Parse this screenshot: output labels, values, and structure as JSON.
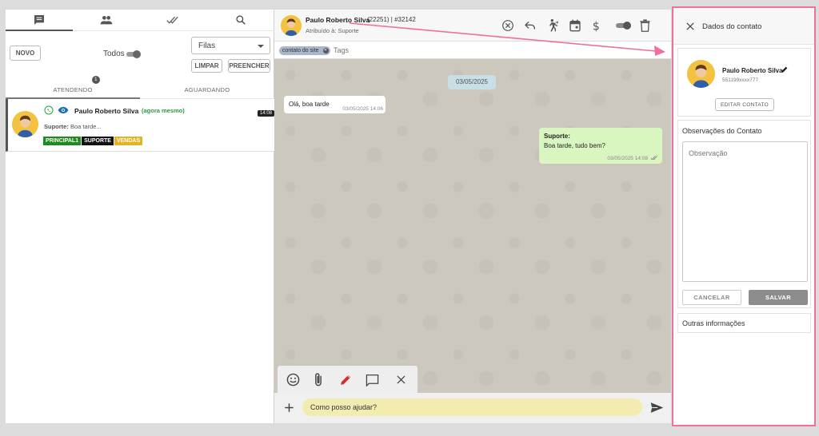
{
  "left_panel": {
    "tabs": [
      {
        "icon": "chat-bubble-icon"
      },
      {
        "icon": "people-icon"
      },
      {
        "icon": "double-check-icon"
      },
      {
        "icon": "search-icon"
      }
    ],
    "new_button": "NOVO",
    "all_label": "Todos",
    "queues_select": "Filas",
    "clear_button": "LIMPAR",
    "fill_button": "PREENCHER",
    "subtabs": [
      "ATENDENDO",
      "AGUARDANDO"
    ],
    "attending_badge": "1",
    "ticket": {
      "name": "Paulo Roberto Silva",
      "time_ago": "(agora mesmo)",
      "time": "14:08",
      "preview_label": "Suporte:",
      "preview_text": "Boa tarde...",
      "tags": [
        {
          "label": "PRINCIPAL1",
          "color": "#1f8a1f"
        },
        {
          "label": "SUPORTE",
          "color": "#111111"
        },
        {
          "label": "VENDAS",
          "color": "#e6b422"
        }
      ]
    }
  },
  "chat": {
    "contact_name": "Paulo Roberto Silva",
    "ticket_info": "(22251) | #32142",
    "assigned": "Atribuído à: Suporte",
    "chip_label": "contato do site",
    "tags_placeholder": "Tags",
    "date_separator": "03/05/2025",
    "messages": [
      {
        "text": "Olá, boa tarde",
        "time": "03/05/2025 14:06",
        "direction": "in"
      },
      {
        "author": "Suporte:",
        "text": "Boa tarde, tudo bem?",
        "time": "03/05/2025 14:08",
        "direction": "out"
      }
    ],
    "input_value": "Como posso ajudar?"
  },
  "contact_panel": {
    "title": "Dados do contato",
    "name": "Paulo Roberto Silva",
    "phone": "551199xxxx777",
    "edit_button": "EDITAR CONTATO",
    "notes_title": "Observações do Contato",
    "notes_placeholder": "Observação",
    "cancel_button": "CANCELAR",
    "save_button": "SALVAR",
    "other_info": "Outras informações"
  },
  "colors": {
    "accent_pink": "#f06fa0",
    "outgoing_bubble": "#d9f5c0",
    "input_bg": "#f2ecb0"
  }
}
